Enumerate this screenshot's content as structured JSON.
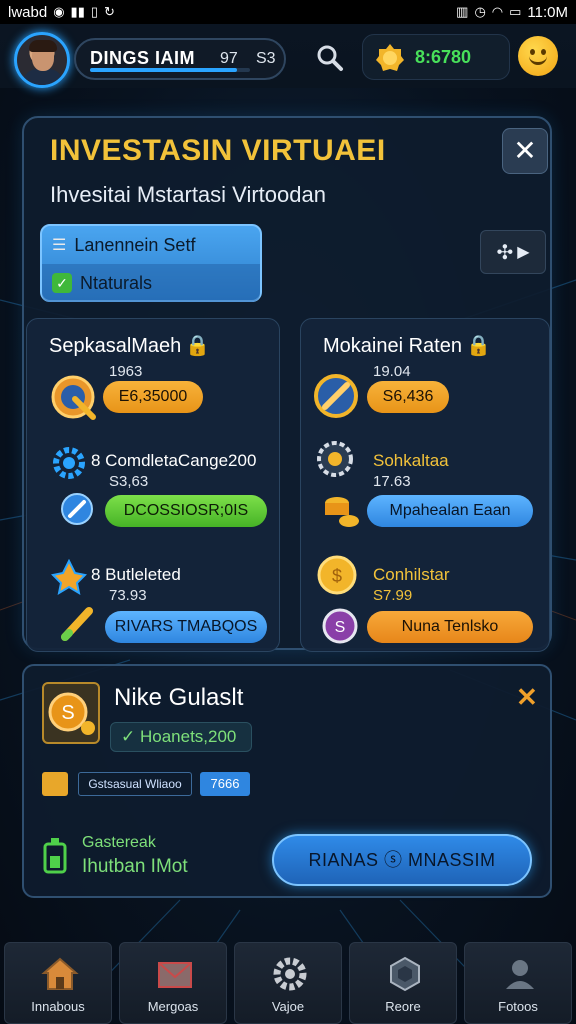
{
  "status_bar": {
    "carrier": "lwabd",
    "time": "11:0M"
  },
  "top_bar": {
    "player_name": "DINGS IAIM",
    "player_level": "97",
    "player_xp": "S3",
    "coins": "8:6780",
    "xp_progress": 0.92
  },
  "panel": {
    "title": "INVESTASIN VIRTUAEI",
    "subtitle": "Ihvesitai Mstartasi Virtoodan",
    "status_option_1": "Lanennein Setf",
    "status_option_2": "Ntaturals",
    "left_card": {
      "title": "SepkasalMaeh",
      "items": [
        {
          "sub": "1963",
          "button": "E6,35000"
        },
        {
          "label": "8 ComdletaCange200",
          "sub": "S3,63",
          "button": "DCOSSIOSR;0IS"
        },
        {
          "label": "8 Butleleted",
          "sub": "73.93",
          "button": "RIVARS TMABQOS"
        }
      ]
    },
    "right_card": {
      "title": "Mokainei Raten",
      "items": [
        {
          "sub": "19.04",
          "button": "S6,436"
        },
        {
          "label": "Sohkaltaa",
          "sub": "17.63",
          "button": "Mpahealan Eaan"
        },
        {
          "label": "Conhilstar",
          "sub": "S7.99",
          "button": "Nuna Tenlsko"
        }
      ]
    }
  },
  "bottom_panel": {
    "name": "Nike Gulaslt",
    "amount": "Hoanets,200",
    "tag": "Gstsasual Wliaoo",
    "tag_number": "7666",
    "status_line_1": "Gastereak",
    "status_line_2": "Ihutban IMot",
    "action_button": "RIANAS ⓢ MNASSIM"
  },
  "nav": {
    "items": [
      {
        "label": "Innabous"
      },
      {
        "label": "Mergoas"
      },
      {
        "label": "Vajoe"
      },
      {
        "label": "Reore"
      },
      {
        "label": "Fotoos"
      }
    ]
  },
  "colors": {
    "accent": "#2aa4ff",
    "title_gold": "#f2c23a",
    "coin_green": "#48e05a",
    "button_orange": "#e89418",
    "button_green": "#46b326",
    "button_blue": "#2f86e0"
  }
}
